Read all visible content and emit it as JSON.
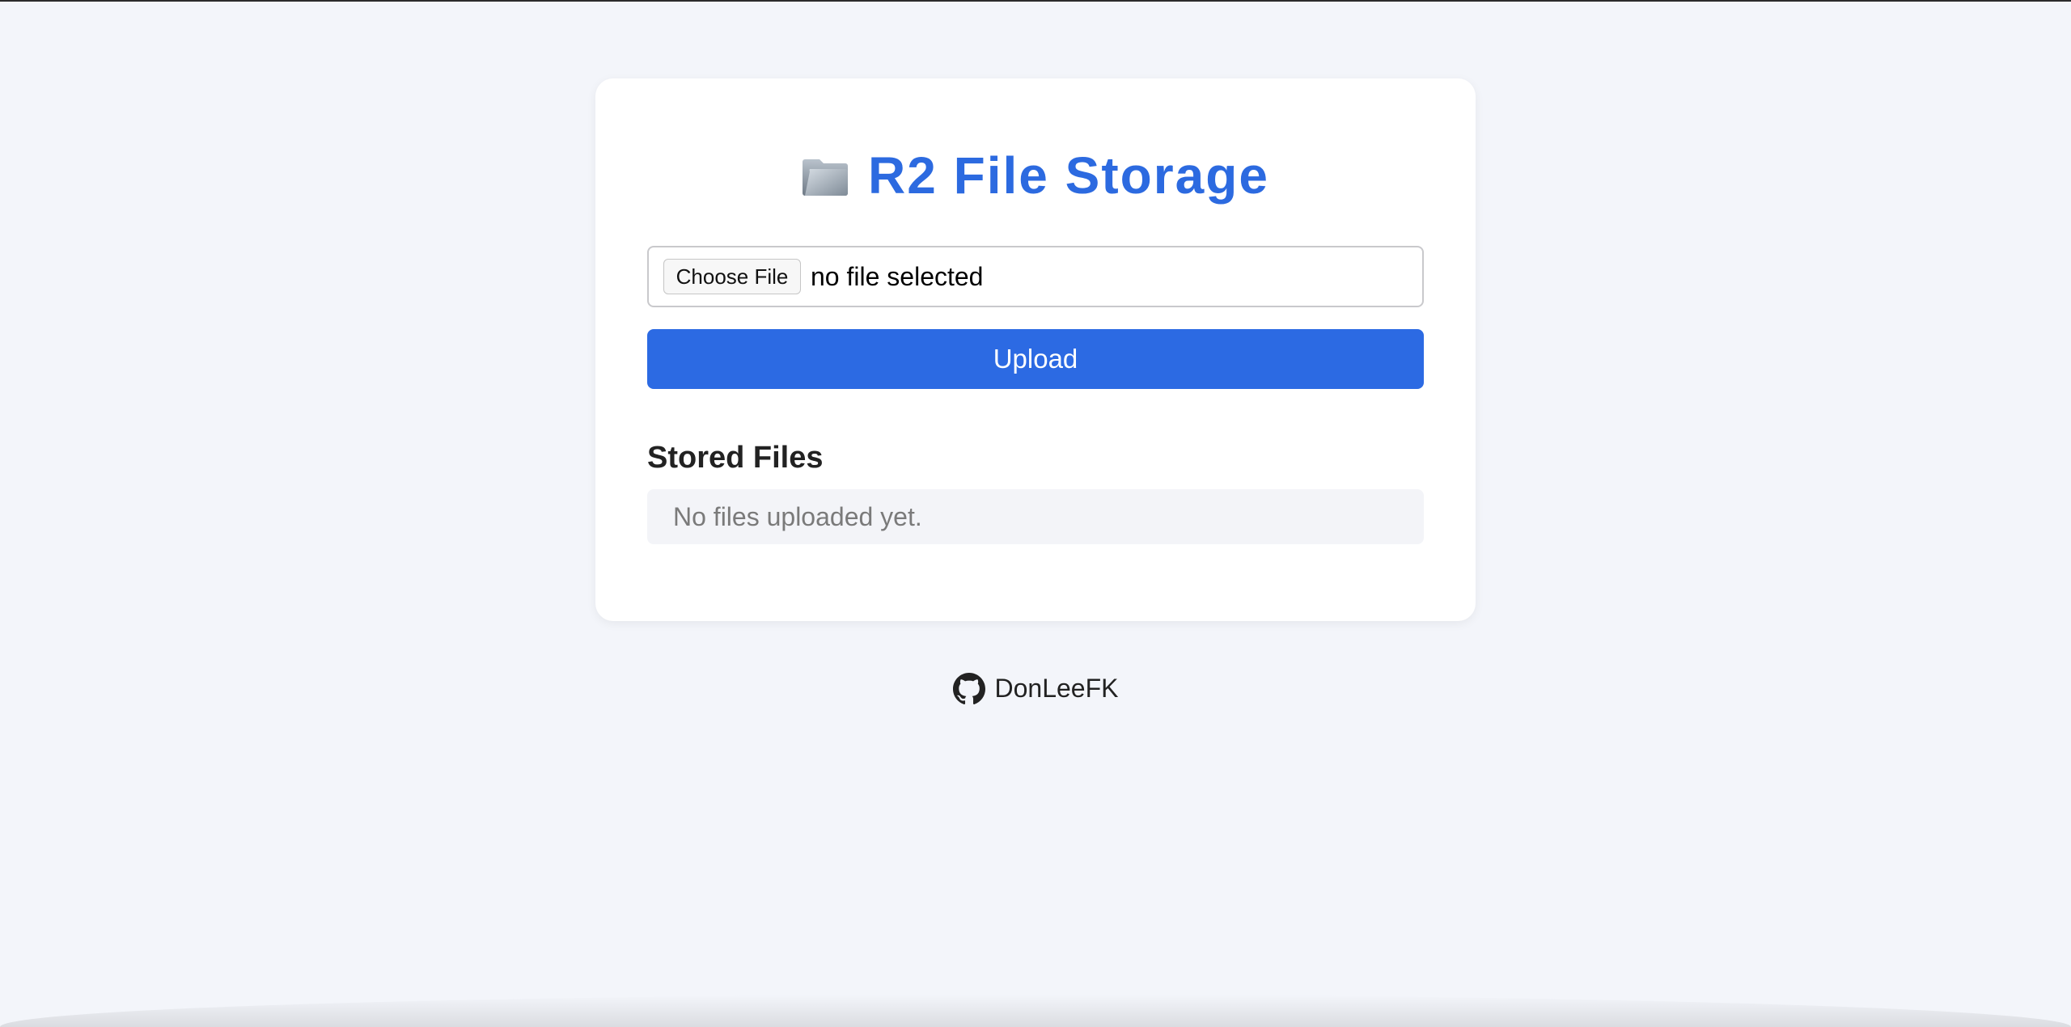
{
  "app": {
    "title": "R2 File Storage",
    "title_icon": "folder-icon",
    "accent_color": "#2c6ae3",
    "background_color": "#f3f5fa"
  },
  "upload_form": {
    "choose_file_label": "Choose File",
    "file_status": "no file selected",
    "upload_label": "Upload"
  },
  "files_section": {
    "heading": "Stored Files",
    "empty_message": "No files uploaded yet.",
    "files": []
  },
  "footer": {
    "icon": "github-icon",
    "link_text": "DonLeeFK"
  }
}
